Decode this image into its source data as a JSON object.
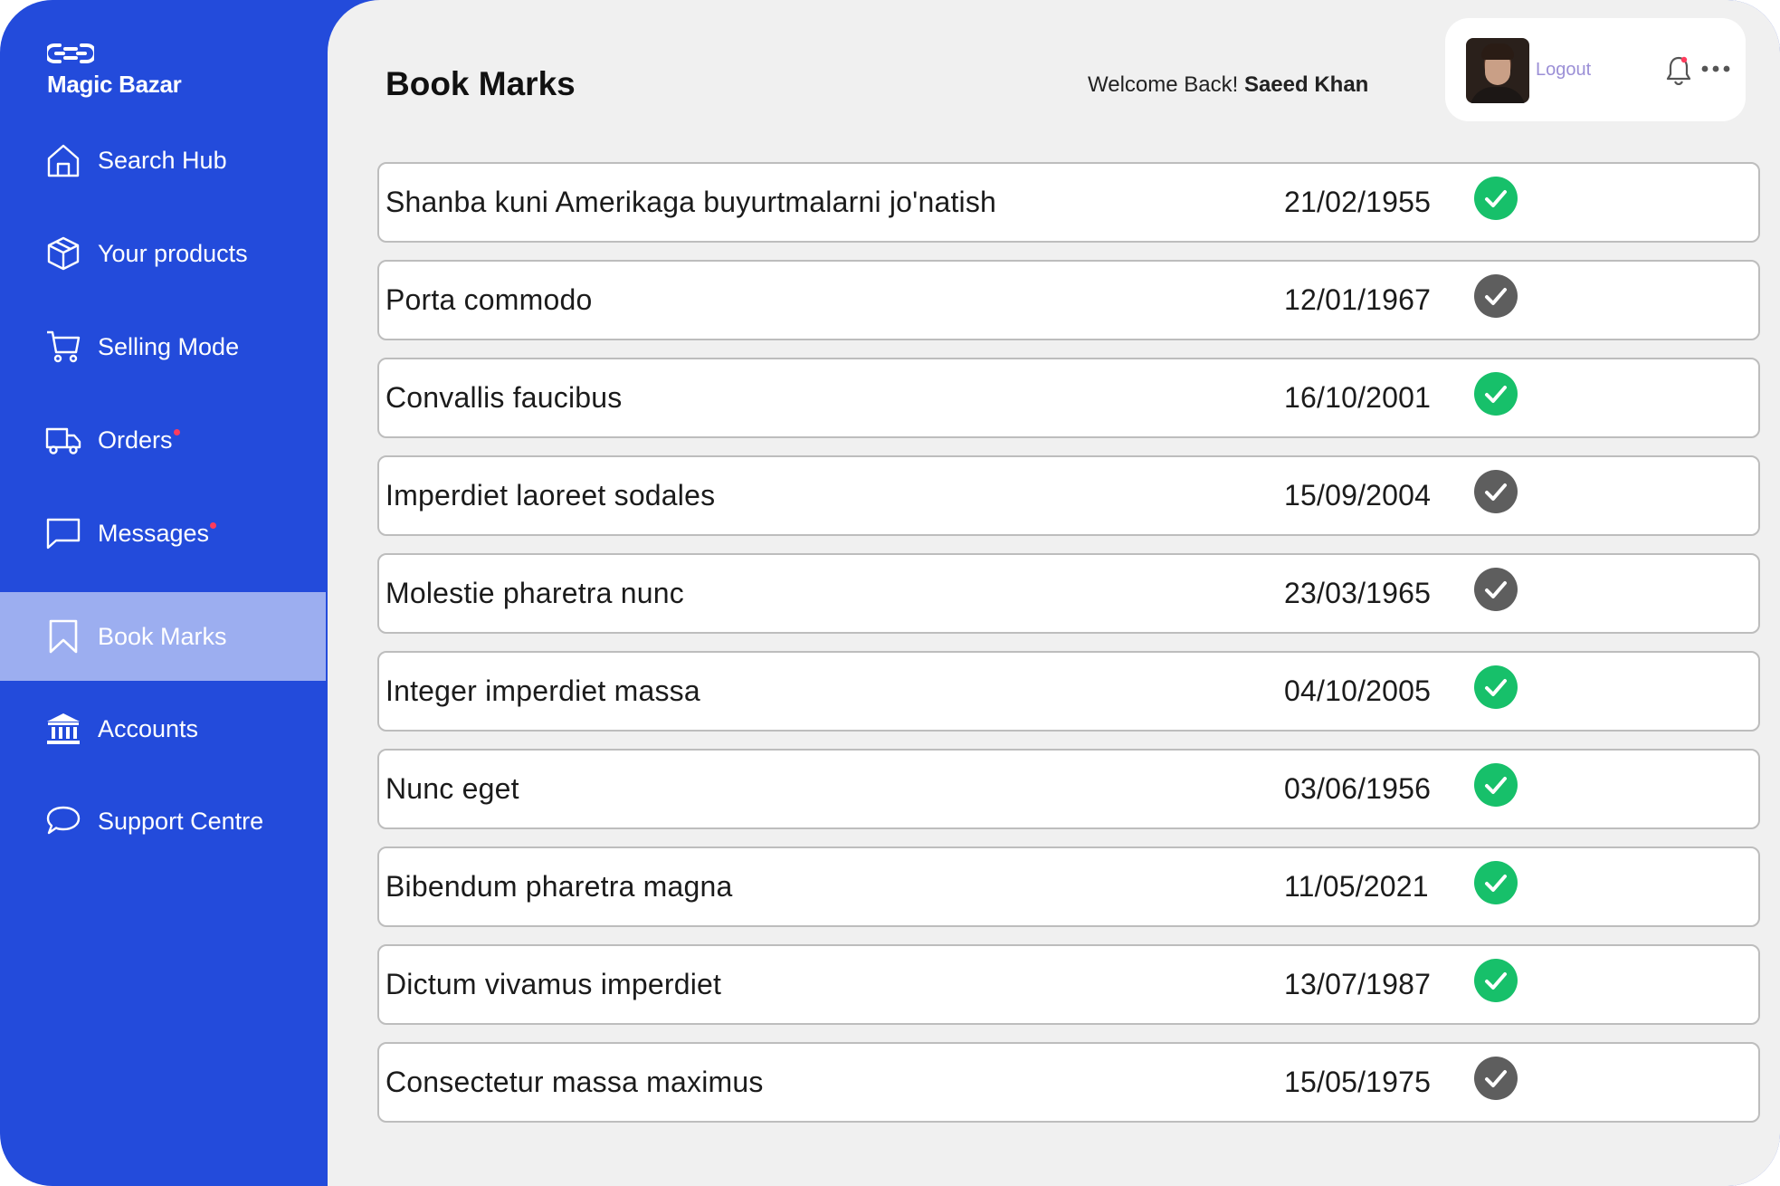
{
  "brand": {
    "name": "Magic Bazar",
    "logo_icon": "infinity-link-icon"
  },
  "sidebar": {
    "active": "Book Marks",
    "items": [
      {
        "label": "Search Hub",
        "icon": "home-icon",
        "badge": false
      },
      {
        "label": "Your products",
        "icon": "box-icon",
        "badge": false
      },
      {
        "label": "Selling Mode",
        "icon": "cart-icon",
        "badge": false
      },
      {
        "label": "Orders",
        "icon": "truck-icon",
        "badge": true
      },
      {
        "label": "Messages",
        "icon": "message-icon",
        "badge": true
      },
      {
        "label": "Book Marks",
        "icon": "bookmark-icon",
        "badge": false
      },
      {
        "label": "Accounts",
        "icon": "bank-icon",
        "badge": false
      },
      {
        "label": "Support Centre",
        "icon": "chat-bubble-icon",
        "badge": false
      }
    ]
  },
  "header": {
    "title": "Book Marks",
    "welcome_prefix": "Welcome Back!",
    "user_name": "Saeed Khan",
    "logout_label": "Logout"
  },
  "colors": {
    "sidebar": "#234bdb",
    "active_item": "#9caef0",
    "check_done": "#17c06a",
    "check_pending": "#5e5e5e",
    "badge": "#ff3b5c"
  },
  "bookmarks": [
    {
      "title": "Shanba kuni Amerikaga buyurtmalarni jo'natish",
      "date": "21/02/1955",
      "done": true
    },
    {
      "title": "Porta commodo",
      "date": "12/01/1967",
      "done": false
    },
    {
      "title": "Convallis faucibus",
      "date": "16/10/2001",
      "done": true
    },
    {
      "title": "Imperdiet laoreet sodales",
      "date": "15/09/2004",
      "done": false
    },
    {
      "title": "Molestie pharetra nunc",
      "date": "23/03/1965",
      "done": false
    },
    {
      "title": "Integer imperdiet massa",
      "date": "04/10/2005",
      "done": true
    },
    {
      "title": "Nunc eget",
      "date": "03/06/1956",
      "done": true
    },
    {
      "title": "Bibendum pharetra magna",
      "date": "11/05/2021",
      "done": true
    },
    {
      "title": "Dictum vivamus imperdiet",
      "date": "13/07/1987",
      "done": true
    },
    {
      "title": "Consectetur massa maximus",
      "date": "15/05/1975",
      "done": false
    }
  ]
}
